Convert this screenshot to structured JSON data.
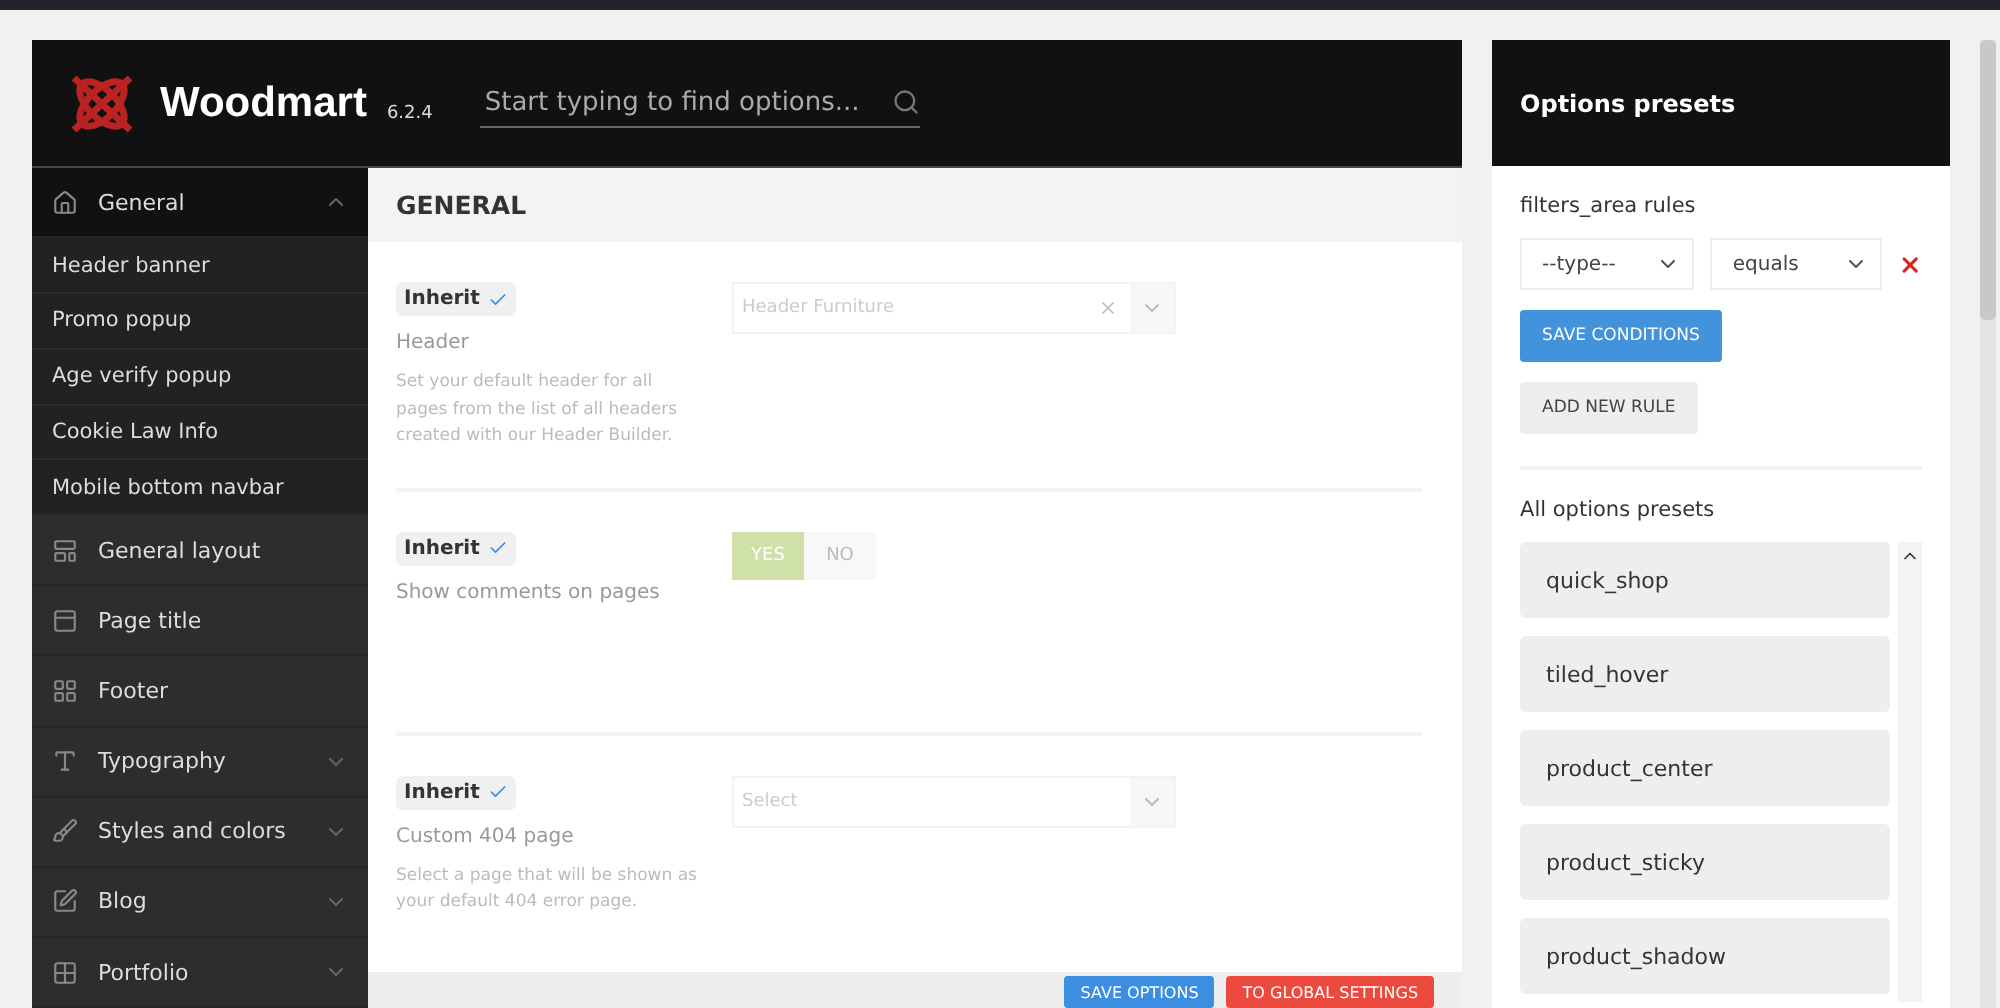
{
  "app": {
    "name": "Woodmart",
    "version": "6.2.4",
    "search_placeholder": "Start typing to find options..."
  },
  "sidebar": {
    "items": [
      {
        "label": "General",
        "selected": true,
        "expanded": true,
        "children": [
          {
            "label": "Header banner"
          },
          {
            "label": "Promo popup"
          },
          {
            "label": "Age verify popup"
          },
          {
            "label": "Cookie Law Info"
          },
          {
            "label": "Mobile bottom navbar"
          }
        ]
      },
      {
        "label": "General layout",
        "selected": false
      },
      {
        "label": "Page title",
        "selected": false
      },
      {
        "label": "Footer",
        "selected": false
      },
      {
        "label": "Typography",
        "selected": false,
        "expanded": false
      },
      {
        "label": "Styles and colors",
        "selected": false,
        "expanded": false
      },
      {
        "label": "Blog",
        "selected": false,
        "expanded": false
      },
      {
        "label": "Portfolio",
        "selected": false,
        "expanded": false
      }
    ]
  },
  "content": {
    "title": "GENERAL",
    "settings": [
      {
        "kind": "select",
        "inherit": "Inherit",
        "inherit_checked": true,
        "title": "Header",
        "description": "Set your default header for all pages from the list of all headers created with our Header Builder.",
        "value": "Header Furniture",
        "clearable": true
      },
      {
        "kind": "toggle",
        "inherit": "Inherit",
        "inherit_checked": true,
        "title": "Show comments on pages",
        "options": [
          {
            "label": "YES",
            "selected": true
          },
          {
            "label": "NO",
            "selected": false
          }
        ]
      },
      {
        "kind": "select",
        "inherit": "Inherit",
        "inherit_checked": true,
        "title": "Custom 404 page",
        "description": "Select a page that will be shown as your default 404 error page.",
        "placeholder": "Select",
        "clearable": false
      }
    ],
    "buttons": [
      {
        "label": "SAVE OPTIONS",
        "kind": "primary"
      },
      {
        "label": "TO GLOBAL SETTINGS",
        "kind": "danger"
      }
    ]
  },
  "presets": {
    "title": "Options presets",
    "rules_title": "filters_area rules",
    "rule": {
      "type": "--type--",
      "operator": "equals"
    },
    "save_button": "SAVE CONDITIONS",
    "add_button": "ADD NEW RULE",
    "list_title": "All options presets",
    "items": [
      {
        "label": "quick_shop"
      },
      {
        "label": "tiled_hover"
      },
      {
        "label": "product_center"
      },
      {
        "label": "product_sticky"
      },
      {
        "label": "product_shadow"
      }
    ]
  }
}
